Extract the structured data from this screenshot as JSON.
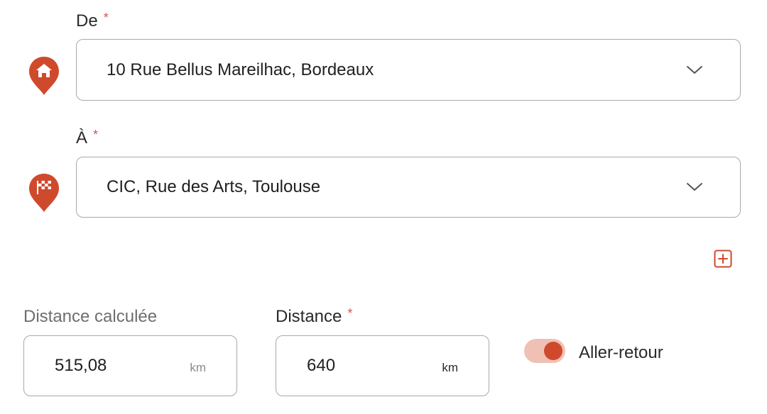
{
  "colors": {
    "accent": "#cf4a2c",
    "toggle_track": "#efc1b4",
    "border": "#a9a9a9",
    "required": "#d9534f"
  },
  "from": {
    "label": "De",
    "required_mark": "*",
    "value": "10 Rue Bellus Mareilhac, Bordeaux",
    "icon": "home-pin-icon"
  },
  "to": {
    "label": "À",
    "required_mark": "*",
    "value": "CIC, Rue des Arts, Toulouse",
    "icon": "finish-flag-pin-icon"
  },
  "add_step": {
    "icon": "plus-square-icon"
  },
  "calculated_distance": {
    "label": "Distance calculée",
    "value": "515,08",
    "unit": "km"
  },
  "distance": {
    "label": "Distance",
    "required_mark": "*",
    "value": "640",
    "unit": "km"
  },
  "round_trip": {
    "label": "Aller-retour",
    "enabled": true
  }
}
